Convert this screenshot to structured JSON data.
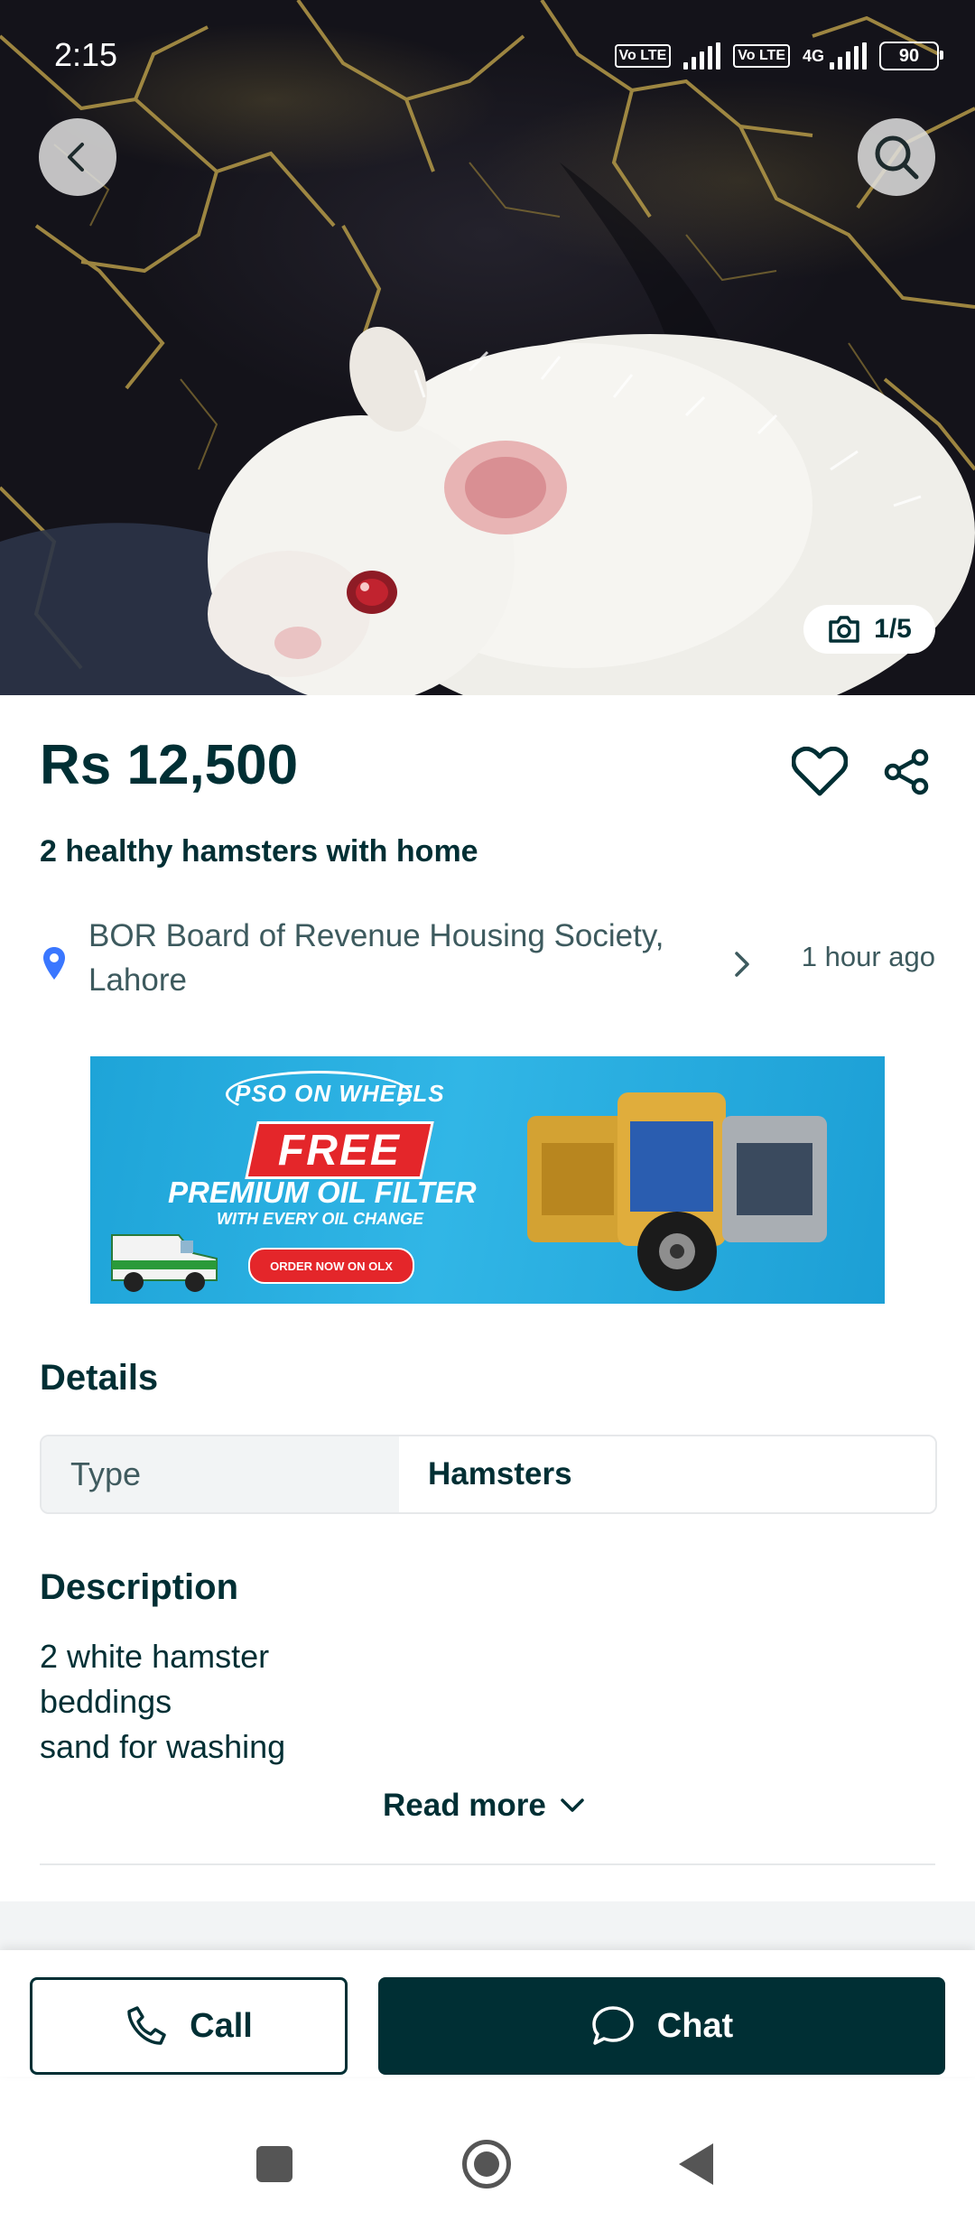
{
  "status_bar": {
    "time": "2:15",
    "network_1": "Vo LTE",
    "network_2": "Vo LTE",
    "network_type": "4G",
    "battery": "90"
  },
  "gallery": {
    "counter": "1/5",
    "back_icon": "chevron-left-icon",
    "search_icon": "search-icon",
    "camera_icon": "camera-icon"
  },
  "listing": {
    "price": "Rs 12,500",
    "title": "2 healthy hamsters with home",
    "location": "BOR Board of Revenue Housing Society, Lahore",
    "posted": "1 hour ago"
  },
  "ad": {
    "brand": "PSO ON WHEELS",
    "headline": "FREE",
    "line1": "PREMIUM OIL FILTER",
    "line2": "WITH EVERY OIL CHANGE",
    "cta": "ORDER NOW ON OLX"
  },
  "details": {
    "heading": "Details",
    "rows": [
      {
        "key": "Type",
        "value": "Hamsters"
      }
    ]
  },
  "description": {
    "heading": "Description",
    "lines": [
      "2 white hamster",
      "beddings",
      "sand for washing"
    ],
    "read_more": "Read more"
  },
  "actions": {
    "call": "Call",
    "chat": "Chat"
  },
  "colors": {
    "primary": "#002f34",
    "muted_text": "#3d5a5e",
    "pin": "#3a77ff",
    "ad_background": "#1ea4d8",
    "ad_red": "#e4262a"
  }
}
